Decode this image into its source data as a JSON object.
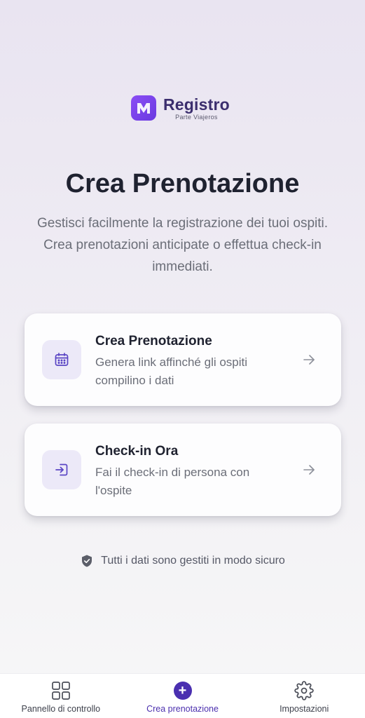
{
  "logo": {
    "name": "Registro",
    "sub": "Parte Viajeros"
  },
  "page": {
    "title": "Crea Prenotazione",
    "subtitle": "Gestisci facilmente la registrazione dei tuoi ospiti. Crea prenotazioni anticipate o effettua check-in immediati."
  },
  "cards": [
    {
      "icon": "calendar-icon",
      "title": "Crea Prenotazione",
      "description": "Genera link affinché gli ospiti compilino i dati"
    },
    {
      "icon": "check-in-icon",
      "title": "Check-in Ora",
      "description": "Fai il check-in di persona con l'ospite"
    }
  ],
  "secure_note": {
    "icon": "shield-check-icon",
    "text": "Tutti i dati sono gestiti in modo sicuro"
  },
  "nav": {
    "items": [
      {
        "label": "Pannello di controllo",
        "icon": "grid-icon",
        "active": false
      },
      {
        "label": "Crea prenotazione",
        "icon": "plus-circle-icon",
        "active": true
      },
      {
        "label": "Impostazioni",
        "icon": "gear-icon",
        "active": false
      }
    ]
  },
  "colors": {
    "accent": "#4a2fb0",
    "logo_gradient_start": "#8b4df5",
    "logo_gradient_end": "#6a3ae0",
    "icon_tile_bg": "#ece9f8",
    "title_text": "#1f2230",
    "muted_text": "#6b6e78"
  }
}
